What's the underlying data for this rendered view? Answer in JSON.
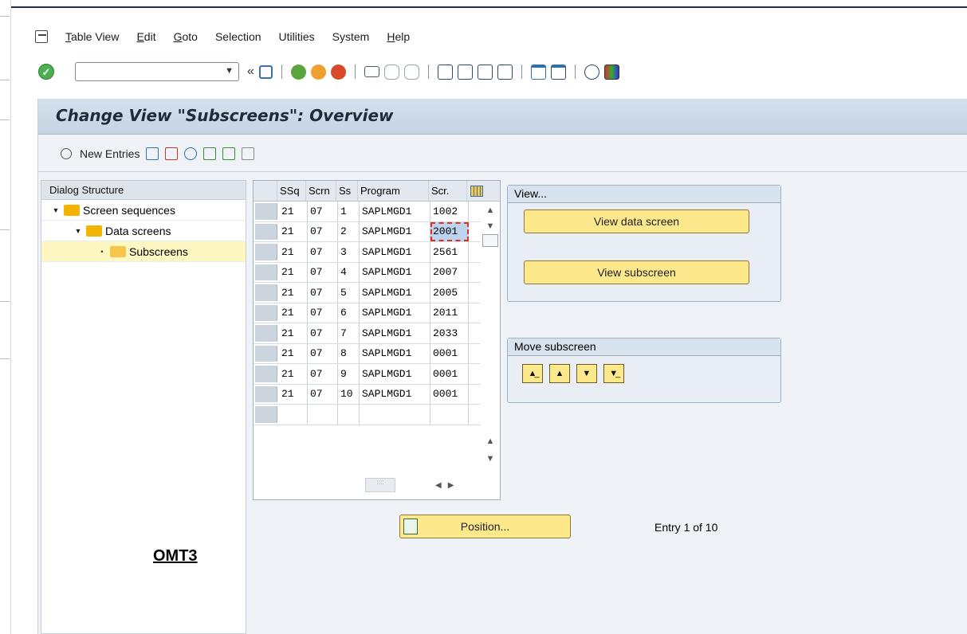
{
  "menu": {
    "items": [
      {
        "label": "Table View",
        "u": "T",
        "rest": "able View"
      },
      {
        "label": "Edit",
        "u": "E",
        "rest": "dit"
      },
      {
        "label": "Goto",
        "u": "G",
        "rest": "oto"
      },
      {
        "label": "Selection",
        "u": "",
        "rest": "Selection"
      },
      {
        "label": "Utilities",
        "u": "",
        "rest": "Utilities"
      },
      {
        "label": "System",
        "u": "",
        "rest": "System"
      },
      {
        "label": "Help",
        "u": "H",
        "rest": "elp"
      }
    ]
  },
  "toolbar": {
    "command_value": "",
    "back_glyph": "«"
  },
  "title": "Change View \"Subscreens\": Overview",
  "app_toolbar": {
    "new_entries_label": "New Entries"
  },
  "dialog_structure": {
    "header": "Dialog Structure",
    "nodes": [
      {
        "label": "Screen sequences",
        "level": 0
      },
      {
        "label": "Data screens",
        "level": 1
      },
      {
        "label": "Subscreens",
        "level": 2,
        "selected": true
      }
    ]
  },
  "table": {
    "columns": [
      "SSq",
      "Scrn",
      "Ss",
      "Program",
      "Scr."
    ],
    "rows": [
      [
        "21",
        "07",
        "1",
        "SAPLMGD1",
        "1002"
      ],
      [
        "21",
        "07",
        "2",
        "SAPLMGD1",
        "2001"
      ],
      [
        "21",
        "07",
        "3",
        "SAPLMGD1",
        "2561"
      ],
      [
        "21",
        "07",
        "4",
        "SAPLMGD1",
        "2007"
      ],
      [
        "21",
        "07",
        "5",
        "SAPLMGD1",
        "2005"
      ],
      [
        "21",
        "07",
        "6",
        "SAPLMGD1",
        "2011"
      ],
      [
        "21",
        "07",
        "7",
        "SAPLMGD1",
        "2033"
      ],
      [
        "21",
        "07",
        "8",
        "SAPLMGD1",
        "0001"
      ],
      [
        "21",
        "07",
        "9",
        "SAPLMGD1",
        "0001"
      ],
      [
        "21",
        "07",
        "10",
        "SAPLMGD1",
        "0001"
      ]
    ]
  },
  "view_group": {
    "title": "View...",
    "data_screen_btn": "View data screen",
    "subscreen_btn": "View subscreen"
  },
  "move_group": {
    "title": "Move subscreen"
  },
  "position_btn": "Position...",
  "entry_info": "Entry 1 of 10",
  "annotation": "OMT3",
  "colors": {
    "accent_yellow": "#fde98b",
    "panel": "#eff3f7",
    "title_bar": "#c6d5e4",
    "selected_row": "#fff7c2"
  }
}
